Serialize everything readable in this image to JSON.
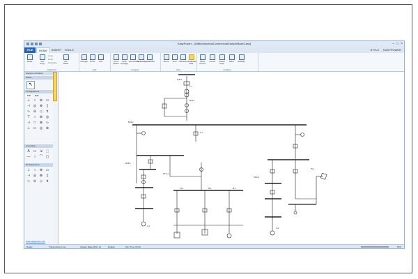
{
  "window": {
    "title": "EasyPower - [UtilityIndustrialCommercialSampleBaseCase]",
    "controls": {
      "minimize": "–",
      "maximize": "□",
      "close": "×"
    }
  },
  "tabs": [
    {
      "label": "FILE"
    },
    {
      "label": "HOME"
    },
    {
      "label": "INSERT"
    },
    {
      "label": "TOOLS"
    }
  ],
  "user": {
    "style": "STYLE",
    "name": "EASYPOWER"
  },
  "ribbon": {
    "groups": [
      {
        "label": "Clipboard"
      },
      {
        "label": "Edit"
      },
      {
        "label": "Analysis"
      },
      {
        "label": "View"
      },
      {
        "label": "Analysis"
      }
    ],
    "buttons": [
      {
        "label": "Paste"
      },
      {
        "label": "Cut Copy"
      },
      {
        "label": "Arc Flash"
      },
      {
        "label": "Change"
      },
      {
        "label": "Icons"
      },
      {
        "label": "Text"
      },
      {
        "label": "Print Select"
      },
      {
        "label": "Auto Arrange"
      },
      {
        "label": "Harmonics"
      },
      {
        "label": "Reliability"
      },
      {
        "label": "Database"
      },
      {
        "label": "Zoom"
      },
      {
        "label": "Find"
      },
      {
        "label": "Window"
      },
      {
        "label": "Database Edit"
      },
      {
        "label": "Short Circuit"
      },
      {
        "label": "Coord"
      },
      {
        "label": "Power Flow"
      },
      {
        "label": "Harm"
      },
      {
        "label": "Stability"
      }
    ],
    "small_buttons": [
      "Undo",
      "Redo",
      "Duplicate"
    ]
  },
  "sidebar": {
    "title": "Equipment Palette",
    "sections": [
      {
        "label": "Select"
      },
      {
        "label": "AC Equipment"
      },
      {
        "label": "Annotation"
      },
      {
        "label": "DC Equipment"
      }
    ],
    "sub_tabs": [
      "Edit",
      "Edit"
    ],
    "footer_link": "www.easypower.com"
  },
  "icons": {
    "ac": [
      "⊥",
      "○",
      "⊕",
      "▭",
      "⊣",
      "◎",
      "⊗",
      "▯",
      "∿",
      "⊖",
      "◇",
      "↯",
      "⊤",
      "○",
      "⊕",
      "◎",
      "⊣",
      "□",
      "⊗",
      "∿",
      "⊥",
      "▭",
      "◎",
      "⊕"
    ],
    "annot": [
      "A",
      "▭",
      "⇲",
      "⬚",
      "—",
      "○",
      "⌒",
      "▢"
    ],
    "dc": [
      "⊥",
      "○",
      "⊕",
      "▭",
      "⊣",
      "◎",
      "⊗",
      "▯",
      "∿",
      "⊖",
      "◇",
      "↯"
    ]
  },
  "statusbar": {
    "mode": "Ready",
    "info1": "Transmission Line",
    "info2": "System Base MVA: 10",
    "info3": "Default",
    "info4": "Sim Time: 60 Hz",
    "zoom": "50%"
  },
  "colors": {
    "accent": "#2b64b5",
    "selected": "#f7d66a",
    "label_text": "#1a1aa0"
  }
}
